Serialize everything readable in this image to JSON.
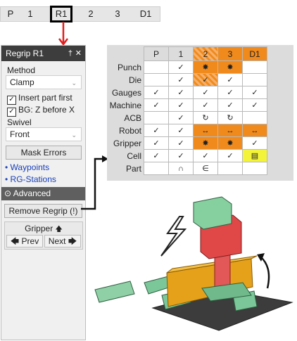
{
  "steps": [
    "P",
    "1",
    "R1",
    "2",
    "3",
    "D1"
  ],
  "panel": {
    "title": "Regrip R1",
    "pin_glyph": "†",
    "close_glyph": "✕",
    "method_label": "Method",
    "method_value": "Clamp",
    "cb_insert": "Insert part first",
    "cb_bg": "BG: Z before X",
    "swivel_label": "Swivel",
    "swivel_value": "Front",
    "mask_errors": "Mask Errors",
    "link_waypoints": "• Waypoints",
    "link_rgstations": "• RG-Stations",
    "advanced": "Advanced",
    "remove_regrip": "Remove Regrip (!)",
    "gripper_label": "Gripper",
    "prev": "Prev",
    "next": "Next"
  },
  "table": {
    "columns": [
      "P",
      "1",
      "2",
      "3",
      "D1"
    ],
    "rows": [
      {
        "label": "Punch",
        "cells": [
          "",
          "✓",
          "✸",
          "✸",
          ""
        ],
        "colors": [
          "w",
          "w",
          "o",
          "o",
          "w"
        ]
      },
      {
        "label": "Die",
        "cells": [
          "",
          "✓",
          "✓",
          "✓",
          ""
        ],
        "colors": [
          "w",
          "w",
          "w",
          "w",
          "w"
        ]
      },
      {
        "label": "Gauges",
        "cells": [
          "✓",
          "✓",
          "✓",
          "✓",
          "✓"
        ],
        "colors": [
          "w",
          "w",
          "w",
          "w",
          "w"
        ]
      },
      {
        "label": "Machine",
        "cells": [
          "✓",
          "✓",
          "✓",
          "✓",
          "✓"
        ],
        "colors": [
          "w",
          "w",
          "w",
          "w",
          "w"
        ]
      },
      {
        "label": "ACB",
        "cells": [
          "",
          "✓",
          "↻",
          "↻",
          ""
        ],
        "colors": [
          "w",
          "w",
          "w",
          "w",
          "w"
        ]
      },
      {
        "label": "Robot",
        "cells": [
          "✓",
          "✓",
          "↔",
          "↔",
          "↔"
        ],
        "colors": [
          "w",
          "w",
          "o",
          "o",
          "o"
        ]
      },
      {
        "label": "Gripper",
        "cells": [
          "✓",
          "✓",
          "✸",
          "✸",
          "✓"
        ],
        "colors": [
          "w",
          "w",
          "o",
          "o",
          "w"
        ]
      },
      {
        "label": "Cell",
        "cells": [
          "✓",
          "✓",
          "✓",
          "✓",
          "▤"
        ],
        "colors": [
          "w",
          "w",
          "w",
          "w",
          "y"
        ]
      },
      {
        "label": "Part",
        "cells": [
          "",
          "∩",
          "∈",
          "",
          ""
        ],
        "colors": [
          "w",
          "w",
          "w",
          "w",
          "w"
        ]
      }
    ]
  },
  "colors": {
    "orange": "#f08a1c",
    "yellow": "#f3f33a",
    "red": "#e53b3b",
    "dark": "#3d3d3d"
  }
}
